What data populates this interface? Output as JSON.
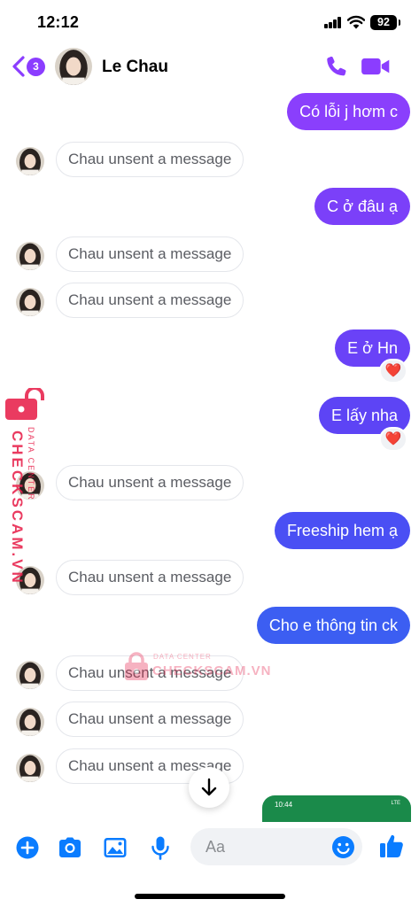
{
  "status_bar": {
    "time": "12:12",
    "battery": "92"
  },
  "header": {
    "back_badge": "3",
    "contact_name": "Le Chau"
  },
  "messages": [
    {
      "side": "out",
      "text": "Có lỗi j hơm c"
    },
    {
      "side": "in",
      "text": "Chau unsent a message"
    },
    {
      "side": "out",
      "text": "C ở đâu ạ"
    },
    {
      "side": "in",
      "text": "Chau unsent a message"
    },
    {
      "side": "in",
      "text": "Chau unsent a message"
    },
    {
      "side": "out",
      "text": "E ở Hn",
      "reaction": "❤️"
    },
    {
      "side": "out",
      "text": "E lấy nha",
      "reaction": "❤️"
    },
    {
      "side": "in",
      "text": "Chau unsent a message"
    },
    {
      "side": "out",
      "text": "Freeship hem ạ"
    },
    {
      "side": "in",
      "text": "Chau unsent a message"
    },
    {
      "side": "out",
      "text": "Cho e thông tin ck"
    },
    {
      "side": "in",
      "text": "Chau unsent a message"
    },
    {
      "side": "in",
      "text": "Chau unsent a message"
    },
    {
      "side": "in",
      "text": "Chau unsent a message"
    }
  ],
  "image_preview": {
    "time": "10:44",
    "status": "LTE"
  },
  "watermark": {
    "brand": "CHECKSCAM.VN",
    "sub": "DATA CENTER"
  },
  "composer": {
    "placeholder": "Aa"
  },
  "colors": {
    "accent": "#8b3dff",
    "bubble_purple": "#8a3ffc",
    "bubble_violet": "#6a42f7",
    "bubble_blue": "#3c5ef2",
    "icon_blue": "#0a7cff"
  }
}
